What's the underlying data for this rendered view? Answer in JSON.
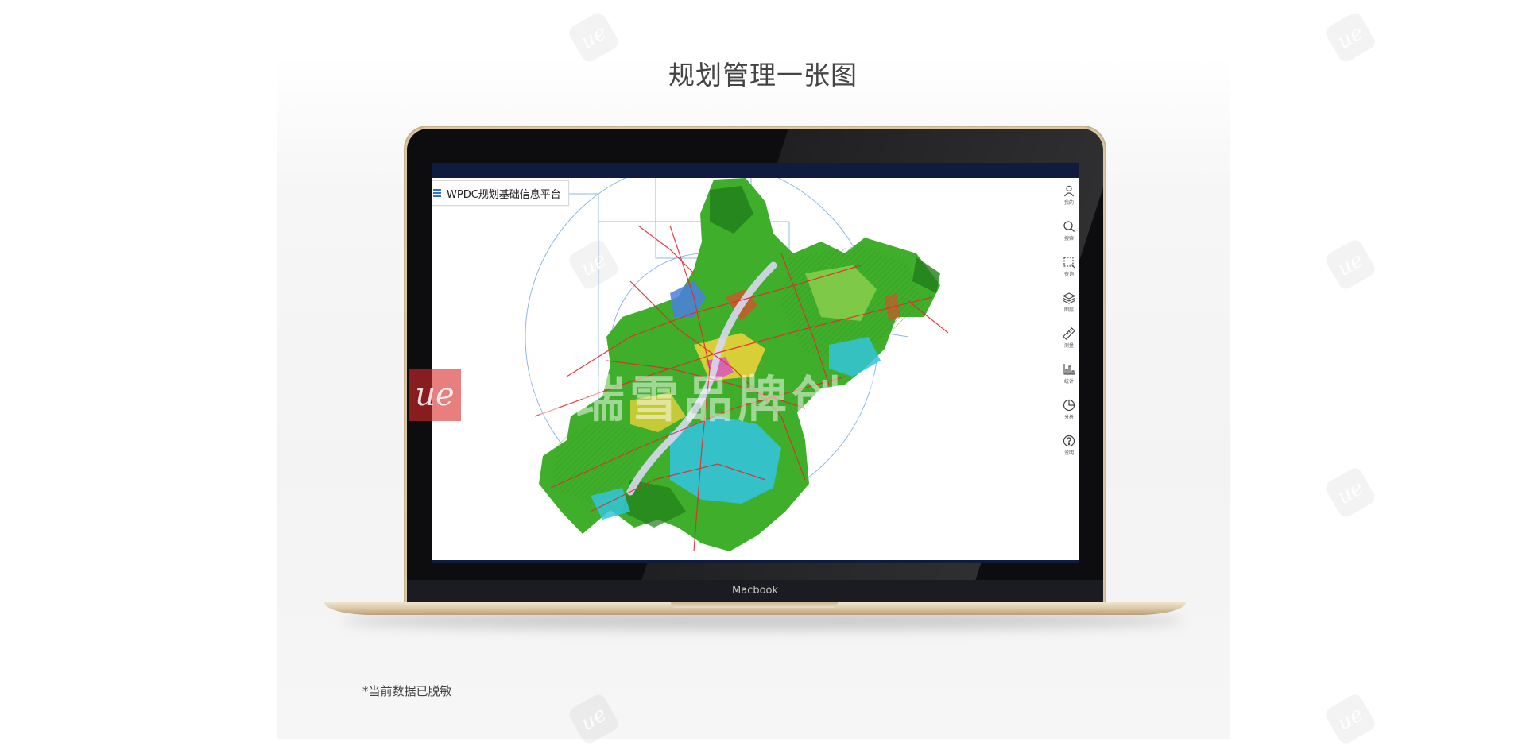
{
  "page": {
    "title": "规划管理一张图"
  },
  "app": {
    "title": "WPDC规划基础信息平台"
  },
  "toolbar": {
    "items": [
      {
        "label": "我的",
        "icon": "user-icon"
      },
      {
        "label": "搜索",
        "icon": "search-icon"
      },
      {
        "label": "查询",
        "icon": "select-box-icon"
      },
      {
        "label": "图层",
        "icon": "layers-icon"
      },
      {
        "label": "测量",
        "icon": "ruler-icon"
      },
      {
        "label": "统计",
        "icon": "bar-chart-icon"
      },
      {
        "label": "分析",
        "icon": "pie-chart-icon"
      },
      {
        "label": "说明",
        "icon": "help-icon"
      }
    ]
  },
  "laptop": {
    "brand": "Macbook"
  },
  "footer": {
    "disclaimer": "*当前数据已脱敏"
  },
  "watermark": {
    "logo_text": "ue",
    "text": "武汉瑞雪品牌创作集"
  },
  "colors": {
    "accent": "#2f6fd6",
    "header_bar": "#101c3f",
    "map_green": "#3fae2a",
    "map_water": "#33c4d9",
    "map_road": "#e32b2b",
    "laptop_gold": "#d9c7a6"
  }
}
